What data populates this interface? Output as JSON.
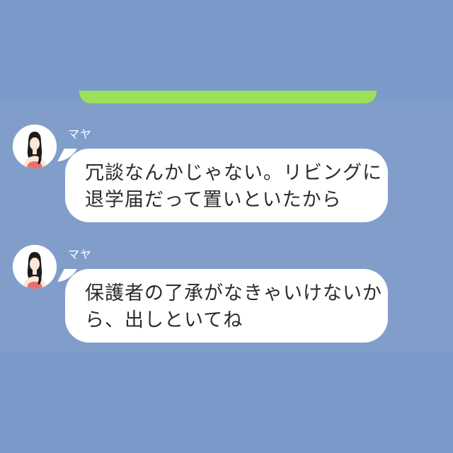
{
  "colors": {
    "background": "#7b98c8",
    "chat_background": "#819ecb",
    "bubble": "#ffffff",
    "sent_bubble": "#9bdf5a",
    "text": "#2c2c2c",
    "sender_name": "#ffffff"
  },
  "messages": [
    {
      "sender": "マヤ",
      "avatar_icon": "woman-avatar-icon",
      "lines": [
        "冗談なんかじゃない。リビングに",
        "退学届だって置いといたから"
      ]
    },
    {
      "sender": "マヤ",
      "avatar_icon": "woman-avatar-icon",
      "lines": [
        "保護者の了承がなきゃいけないか",
        "ら、出しといてね"
      ]
    }
  ]
}
